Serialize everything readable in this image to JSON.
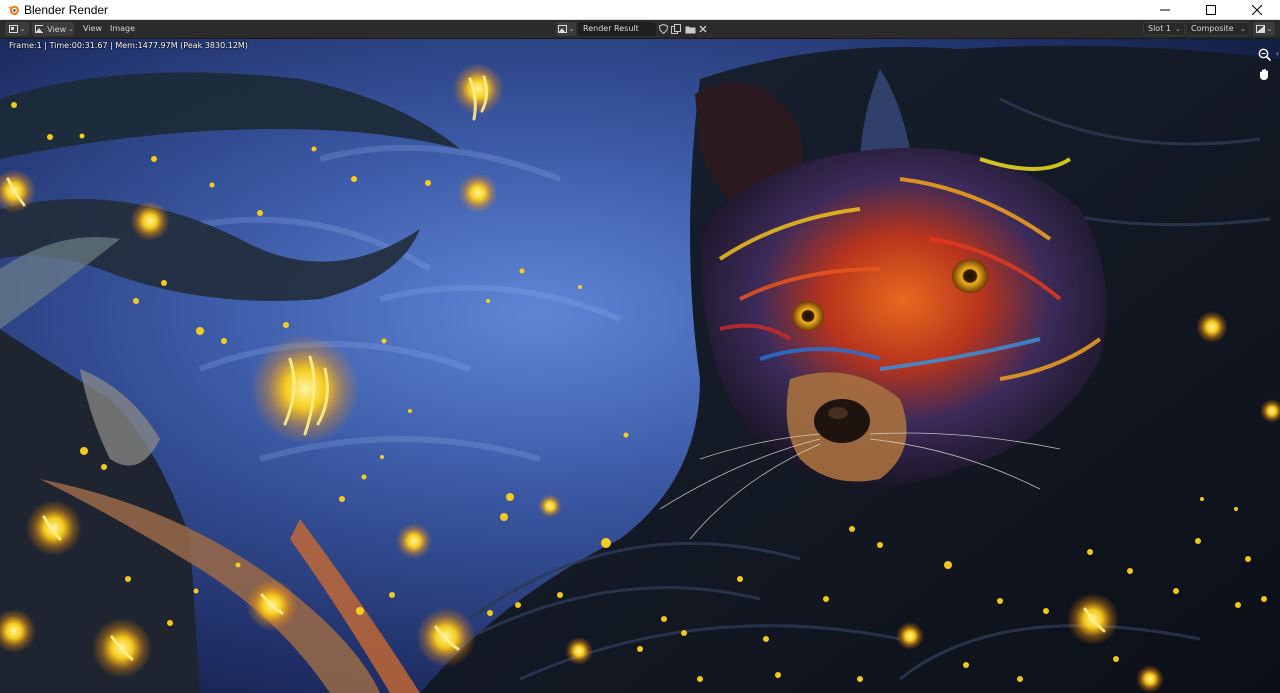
{
  "window": {
    "title": "Blender Render",
    "icon": "blender-logo-icon",
    "controls": [
      "minimize-icon",
      "maximize-icon",
      "close-icon"
    ]
  },
  "header": {
    "editor_type_icon": "image-editor-icon",
    "view_mode_icon": "image-view-icon",
    "view_mode_label": "View",
    "menus": {
      "view": "View",
      "image": "Image"
    },
    "image_browse_icon": "image-browse-icon",
    "image_name": "Render Result",
    "fake_user_icon": "shield-icon",
    "duplicate_icon": "duplicate-icon",
    "open_icon": "folder-icon",
    "unlink_icon": "close-icon",
    "slot": "Slot 1",
    "layer": "Composite",
    "display_icon": "display-channels-icon"
  },
  "viewport": {
    "stats": "Frame:1 | Time:00:31.67 | Mem:1477.97M (Peak 3830.12M)",
    "gizmos": [
      "zoom-icon",
      "hand-pan-icon"
    ],
    "render_subject": "painted fox among glowing yellow flowers"
  },
  "colors": {
    "header_bg": "#2b2b2b",
    "sky_blue": "#3a5aa8",
    "glow_yellow": "#ffd21a",
    "fur_orange": "#e8561c"
  }
}
